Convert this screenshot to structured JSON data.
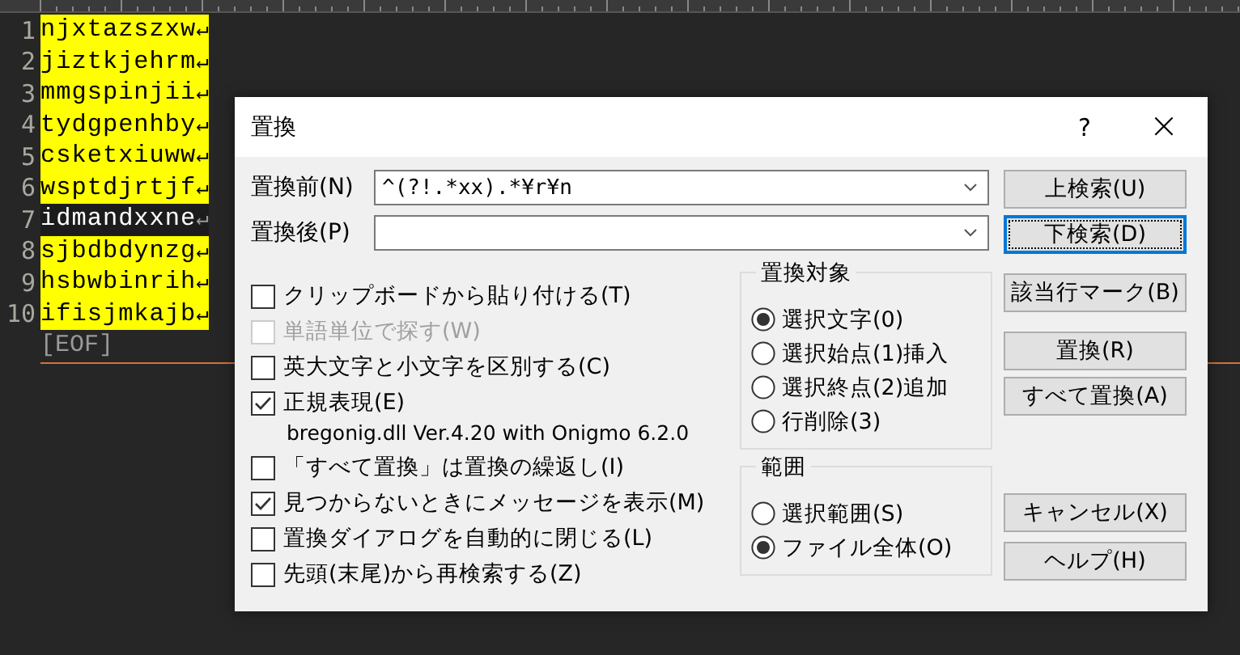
{
  "editor": {
    "lines": [
      {
        "number": "1",
        "text": "njxtazszxw",
        "eol": "↵",
        "marked": true
      },
      {
        "number": "2",
        "text": "jiztkjehrm",
        "eol": "↵",
        "marked": true
      },
      {
        "number": "3",
        "text": "mmgspinjii",
        "eol": "↵",
        "marked": true
      },
      {
        "number": "4",
        "text": "tydgpenhby",
        "eol": "↵",
        "marked": true
      },
      {
        "number": "5",
        "text": "csketxiuww",
        "eol": "↵",
        "marked": true
      },
      {
        "number": "6",
        "text": "wsptdjrtjf",
        "eol": "↵",
        "marked": true
      },
      {
        "number": "7",
        "text": "idmandxxne",
        "eol": "↵",
        "marked": false
      },
      {
        "number": "8",
        "text": "sjbdbdynzg",
        "eol": "↵",
        "marked": true
      },
      {
        "number": "9",
        "text": "hsbwbinrih",
        "eol": "↵",
        "marked": true
      },
      {
        "number": "10",
        "text": "ifisjmkajb",
        "eol": "↵",
        "marked": true
      }
    ],
    "eof": "[EOF]"
  },
  "dialog": {
    "title": "置換",
    "help": "?",
    "close": "×",
    "fields": [
      {
        "label": "置換前(N)",
        "value": "^(?!.*xx).*¥r¥n"
      },
      {
        "label": "置換後(P)"
      }
    ],
    "options": [
      {
        "kind": "checkbox",
        "label": "クリップボードから貼り付ける(T)",
        "checked": false,
        "disabled": false
      },
      {
        "kind": "checkbox",
        "label": "単語単位で探す(W)",
        "checked": false,
        "disabled": true
      },
      {
        "kind": "checkbox",
        "label": "英大文字と小文字を区別する(C)",
        "checked": false,
        "disabled": false
      },
      {
        "kind": "checkbox",
        "label": "正規表現(E)",
        "checked": true,
        "disabled": false
      },
      {
        "kind": "note",
        "label": "bregonig.dll Ver.4.20 with Onigmo 6.2.0"
      },
      {
        "kind": "checkbox",
        "label": "「すべて置換」は置換の繰返し(I)",
        "checked": false,
        "disabled": false
      },
      {
        "kind": "checkbox",
        "label": "見つからないときにメッセージを表示(M)",
        "checked": true,
        "disabled": false
      },
      {
        "kind": "checkbox",
        "label": "置換ダイアログを自動的に閉じる(L)",
        "checked": false,
        "disabled": false
      },
      {
        "kind": "checkbox",
        "label": "先頭(末尾)から再検索する(Z)",
        "checked": false,
        "disabled": false
      }
    ],
    "groups": [
      {
        "title": "置換対象",
        "options": [
          {
            "label": "選択文字(0)",
            "selected": true
          },
          {
            "label": "選択始点(1)挿入",
            "selected": false
          },
          {
            "label": "選択終点(2)追加",
            "selected": false
          },
          {
            "label": "行削除(3)",
            "selected": false
          }
        ]
      },
      {
        "title": "範囲",
        "options": [
          {
            "label": "選択範囲(S)",
            "selected": false
          },
          {
            "label": "ファイル全体(O)",
            "selected": true
          }
        ]
      }
    ],
    "button_groups": [
      [
        {
          "label": "上検索(U)",
          "default": false
        },
        {
          "label": "下検索(D)",
          "default": true
        }
      ],
      [
        {
          "label": "該当行マーク(B)",
          "default": false
        }
      ],
      [
        {
          "label": "置換(R)",
          "default": false
        },
        {
          "label": "すべて置換(A)",
          "default": false
        }
      ],
      [
        {
          "label": "キャンセル(X)",
          "default": false
        },
        {
          "label": "ヘルプ(H)",
          "default": false
        }
      ]
    ]
  }
}
